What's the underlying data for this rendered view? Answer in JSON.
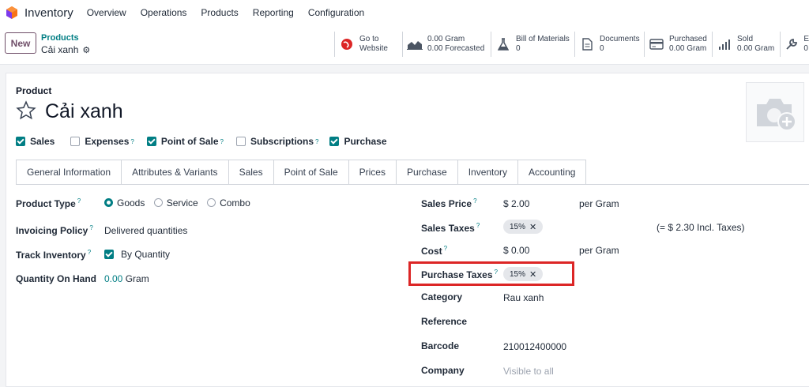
{
  "navbar": {
    "app_name": "Inventory",
    "menu": [
      "Overview",
      "Operations",
      "Products",
      "Reporting",
      "Configuration"
    ]
  },
  "control": {
    "new_label": "New",
    "breadcrumb_parent": "Products",
    "breadcrumb_current": "Cải xanh"
  },
  "smart_buttons": [
    {
      "icon": "globe-icon",
      "top": "Go to",
      "bottom": "Website"
    },
    {
      "icon": "area-chart-icon",
      "top": "0.00 Gram",
      "bottom": "0.00 Forecasted"
    },
    {
      "icon": "flask-icon",
      "top": "Bill of Materials",
      "bottom": "0"
    },
    {
      "icon": "document-icon",
      "top": "Documents",
      "bottom": "0"
    },
    {
      "icon": "credit-card-icon",
      "top": "Purchased",
      "bottom": "0.00 Gram"
    },
    {
      "icon": "bar-chart-icon",
      "top": "Sold",
      "bottom": "0.00 Gram"
    },
    {
      "icon": "wrench-icon",
      "top": "E",
      "bottom": "0"
    }
  ],
  "product": {
    "label": "Product",
    "name": "Cải xanh"
  },
  "flags": [
    {
      "label": "Sales",
      "checked": true,
      "help": ""
    },
    {
      "label": "Expenses",
      "checked": false,
      "help": "?"
    },
    {
      "label": "Point of Sale",
      "checked": true,
      "help": "?"
    },
    {
      "label": "Subscriptions",
      "checked": false,
      "help": "?"
    },
    {
      "label": "Purchase",
      "checked": true,
      "help": ""
    }
  ],
  "tabs": [
    "General Information",
    "Attributes & Variants",
    "Sales",
    "Point of Sale",
    "Prices",
    "Purchase",
    "Inventory",
    "Accounting"
  ],
  "left_fields": {
    "product_type": {
      "label": "Product Type",
      "options": [
        "Goods",
        "Service",
        "Combo"
      ],
      "selected": "Goods"
    },
    "invoicing_policy": {
      "label": "Invoicing Policy",
      "value": "Delivered quantities"
    },
    "track_inventory": {
      "label": "Track Inventory",
      "value": "By Quantity"
    },
    "qty_on_hand": {
      "label": "Quantity On Hand",
      "value": "0.00",
      "unit": "Gram"
    }
  },
  "right_fields": {
    "sales_price": {
      "label": "Sales Price",
      "value": "$ 2.00",
      "unit": "per Gram"
    },
    "sales_taxes": {
      "label": "Sales Taxes",
      "tag": "15%",
      "incl": "(= $ 2.30 Incl. Taxes)"
    },
    "cost": {
      "label": "Cost",
      "value": "$ 0.00",
      "unit": "per Gram"
    },
    "purchase_taxes": {
      "label": "Purchase Taxes",
      "tag": "15%"
    },
    "category": {
      "label": "Category",
      "value": "Rau xanh"
    },
    "reference": {
      "label": "Reference",
      "value": ""
    },
    "barcode": {
      "label": "Barcode",
      "value": "210012400000"
    },
    "company": {
      "label": "Company",
      "placeholder": "Visible to all"
    }
  },
  "help_mark": "?",
  "colors": {
    "accent": "#017e84",
    "brand": "#6f4e68",
    "highlight": "#dc2626"
  }
}
